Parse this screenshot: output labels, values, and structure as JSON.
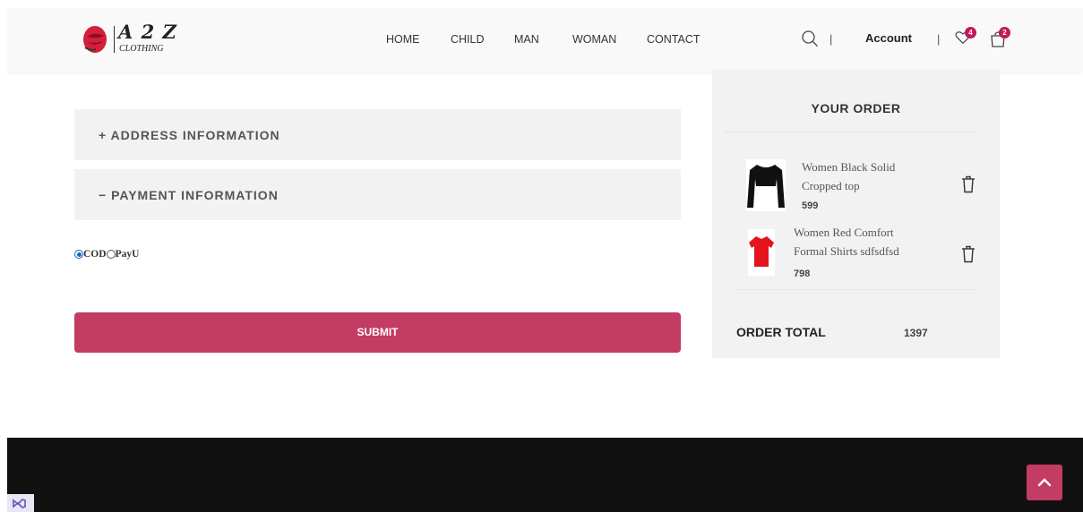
{
  "header": {
    "logo": {
      "text": "A 2 Z",
      "subtitle": "CLOTHING"
    },
    "nav": [
      "HOME",
      "CHILD",
      "MAN",
      "WOMAN",
      "CONTACT"
    ],
    "separator": "|",
    "account_label": "Account",
    "wishlist_count": "4",
    "cart_count": "2",
    "icons": [
      "search-icon",
      "heart-icon",
      "shopping-bag-icon"
    ]
  },
  "checkout": {
    "address_section": "+ ADDRESS INFORMATION",
    "payment_section": "− PAYMENT INFORMATION",
    "payment_options": [
      {
        "label": "COD",
        "selected": true
      },
      {
        "label": "PayU",
        "selected": false
      }
    ],
    "submit_label": "SUBMIT"
  },
  "order": {
    "title": "YOUR ORDER",
    "items": [
      {
        "name_line1": "Women Black Solid",
        "name_line2": "Cropped top",
        "price": "599"
      },
      {
        "name_line1": "Women Red Comfort",
        "name_line2": "Formal Shirts sdfsdfsd",
        "price": "798"
      }
    ],
    "total_label": "ORDER TOTAL",
    "total_value": "1397"
  },
  "colors": {
    "accent": "#c33c63",
    "badge": "#c2185b",
    "panel": "#f2f2f2",
    "footer": "#111112"
  }
}
